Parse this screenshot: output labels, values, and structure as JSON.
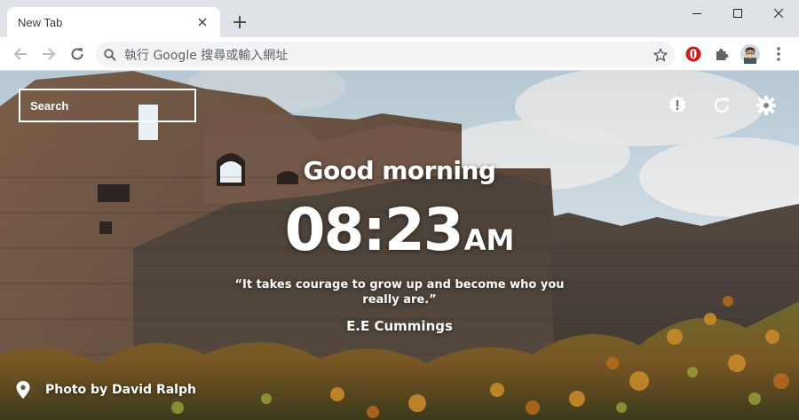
{
  "browser": {
    "tab": {
      "title": "New Tab"
    },
    "address_bar": {
      "placeholder": "執行 Google 搜尋或輸入網址",
      "value": ""
    },
    "accent": "#dee1e6"
  },
  "page": {
    "search": {
      "placeholder": "Search"
    },
    "greeting": "Good morning",
    "clock": {
      "time": "08:23",
      "period": "AM"
    },
    "quote": {
      "text": "“It takes courage to grow up and become who you really are.”",
      "author": "E.E Cummings"
    },
    "photo_credit": "Photo by David Ralph",
    "top_icons": [
      "info-icon",
      "refresh-icon",
      "settings-gear-icon"
    ]
  },
  "icons": {
    "tab_close": "close-icon",
    "new_tab": "plus-icon",
    "back": "arrow-left-icon",
    "forward": "arrow-right-icon",
    "reload": "reload-icon",
    "bookmark": "star-icon",
    "extension_red": "red-shield-icon",
    "extensions": "puzzle-icon",
    "profile": "avatar-icon",
    "menu": "kebab-menu-icon",
    "location": "location-pin-icon"
  }
}
